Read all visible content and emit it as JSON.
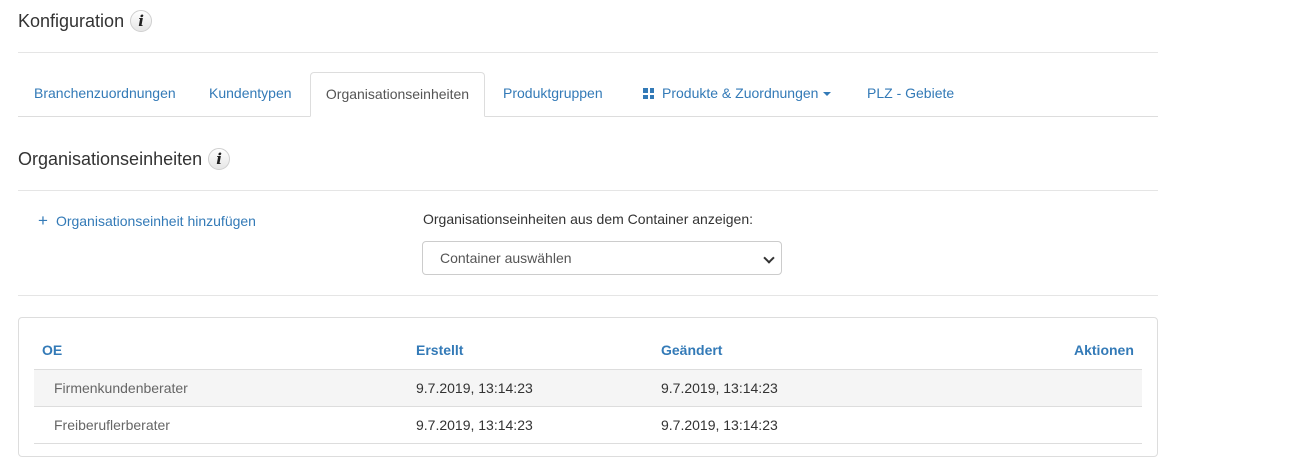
{
  "header": {
    "title": "Konfiguration",
    "info_icon": "i"
  },
  "tabs": [
    {
      "label": "Branchenzuordnungen",
      "active": false
    },
    {
      "label": "Kundentypen",
      "active": false
    },
    {
      "label": "Organisationseinheiten",
      "active": true
    },
    {
      "label": "Produktgruppen",
      "active": false
    },
    {
      "label": "Produkte & Zuordnungen",
      "active": false,
      "icon": "grid-icon",
      "dropdown": true
    },
    {
      "label": "PLZ - Gebiete",
      "active": false
    }
  ],
  "section": {
    "title": "Organisationseinheiten",
    "info_icon": "i"
  },
  "actions": {
    "add_icon": "+",
    "add_label": "Organisationseinheit hinzufügen"
  },
  "container_filter": {
    "label": "Organisationseinheiten aus dem Container anzeigen:",
    "selected": "Container auswählen"
  },
  "table": {
    "columns": [
      "OE",
      "Erstellt",
      "Geändert",
      "Aktionen"
    ],
    "rows": [
      {
        "oe": "Firmenkundenberater",
        "created": "9.7.2019, 13:14:23",
        "changed": "9.7.2019, 13:14:23"
      },
      {
        "oe": "Freiberuflerberater",
        "created": "9.7.2019, 13:14:23",
        "changed": "9.7.2019, 13:14:23"
      }
    ]
  }
}
